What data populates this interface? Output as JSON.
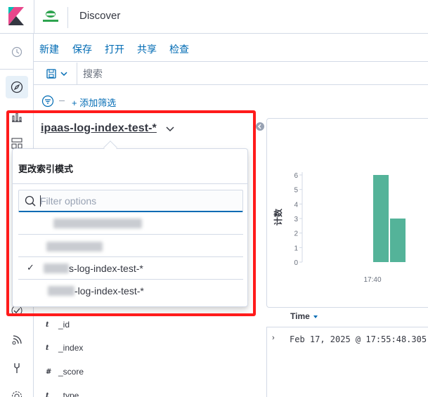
{
  "header": {
    "title": "Discover",
    "brand_color": "#e8478b",
    "space_logo_text": "图标"
  },
  "topnav": {
    "items": [
      "新建",
      "保存",
      "打开",
      "共享",
      "检查"
    ]
  },
  "querybar": {
    "search_placeholder": "搜索"
  },
  "filterbar": {
    "add_filter_label": "+ 添加筛选"
  },
  "sidebar": {
    "index_pattern_title": "ipaas-log-index-test-*",
    "fields": [
      {
        "type": "t",
        "name": "_id"
      },
      {
        "type": "t",
        "name": "_index"
      },
      {
        "type": "#",
        "name": "_score"
      },
      {
        "type": "t",
        "name": "_type"
      }
    ]
  },
  "popover": {
    "title": "更改索引模式",
    "filter_placeholder": "Filter options",
    "options": [
      {
        "label": "",
        "redacted": true,
        "selected": false
      },
      {
        "label": "",
        "redacted": true,
        "selected": false
      },
      {
        "label": "s-log-index-test-*",
        "redacted_prefix": true,
        "selected": true,
        "check": "✓"
      },
      {
        "label": "-log-index-test-*",
        "redacted_prefix": true,
        "selected": false,
        "check": ""
      }
    ]
  },
  "chart_data": {
    "type": "bar",
    "ylabel": "计数",
    "y_ticks": [
      "0",
      "1",
      "2",
      "3",
      "4",
      "5",
      "6"
    ],
    "ylim": [
      0,
      6
    ],
    "x_tick_label": "17:40",
    "bar_color": "#54b399",
    "values": [
      6,
      3
    ]
  },
  "doc_table": {
    "time_column": "Time",
    "rows": [
      {
        "expand": "›",
        "time": "Feb 17, 2025 @ 17:55:48.305"
      }
    ]
  },
  "annotation": {
    "highlight_color": "#ff1b1b"
  }
}
